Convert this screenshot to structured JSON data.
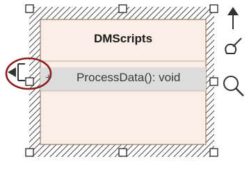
{
  "class_element": {
    "name": "DMScripts",
    "operation": {
      "visibility": "+",
      "signature": "ProcessData(): void"
    }
  },
  "toolbar": {
    "items": [
      {
        "icon": "arrow-up-icon"
      },
      {
        "icon": "brush-icon"
      },
      {
        "icon": "magnifier-icon"
      }
    ]
  },
  "left_connector": {
    "icon": "link-arrow-left-icon",
    "highlighted": true
  },
  "colors": {
    "element_fill": "#fbeee6",
    "element_border": "#9a7a6a",
    "selected_row": "#dcdcdc",
    "hatch": "#444444",
    "highlight_ring": "#8b1c1c"
  }
}
